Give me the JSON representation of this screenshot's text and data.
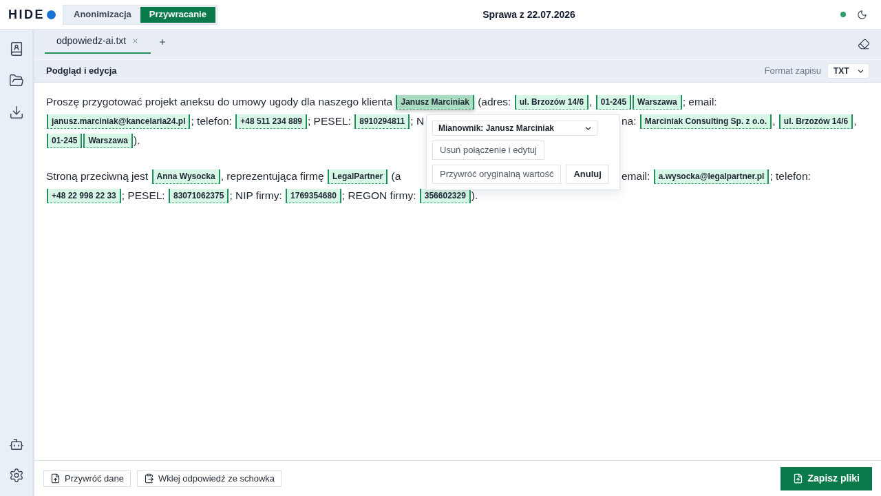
{
  "app": {
    "logo": "HIDE",
    "modes": [
      {
        "label": "Anonimizacja",
        "selected": false
      },
      {
        "label": "Przywracanie",
        "selected": true
      }
    ],
    "case_title": "Sprawa z 22.07.2026"
  },
  "file_tabs": [
    {
      "label": "odpowiedz-ai.txt",
      "selected": true
    }
  ],
  "toolbar": {
    "title": "Podgląd i edycja",
    "format_label": "Format zapisu",
    "format_value": "TXT"
  },
  "document": {
    "paragraphs": [
      {
        "lines": [
          {
            "segments": [
              {
                "kind": "text",
                "text": "Proszę przygotować projekt aneksu do umowy ugody dla naszego klienta "
              },
              {
                "kind": "entity",
                "text": "Janusz Marciniak",
                "selected": true
              },
              {
                "kind": "text",
                "text": " (adres: "
              },
              {
                "kind": "entity",
                "text": "ul. Brzozów 14/6",
                "selected": false
              },
              {
                "kind": "text",
                "text": ", "
              },
              {
                "kind": "entity",
                "text": "01-245",
                "selected": false
              },
              {
                "kind": "entity",
                "text": "Warszawa",
                "selected": false
              },
              {
                "kind": "text",
                "text": "; email:"
              }
            ]
          },
          {
            "segments": [
              {
                "kind": "entity",
                "text": "janusz.marciniak@kancelaria24.pl",
                "selected": false
              },
              {
                "kind": "text",
                "text": "; telefon: "
              },
              {
                "kind": "entity",
                "text": "+48 511 234 889",
                "selected": false
              },
              {
                "kind": "text",
                "text": "; PESEL: "
              },
              {
                "kind": "entity",
                "text": "8910294811",
                "selected": false
              },
              {
                "kind": "text",
                "text": "; N"
              }
            ],
            "after_popup": [
              {
                "kind": "text",
                "text": "na: "
              },
              {
                "kind": "entity",
                "text": "Marciniak Consulting Sp. z o.o.",
                "selected": false
              },
              {
                "kind": "text",
                "text": ", "
              },
              {
                "kind": "entity",
                "text": "ul. Brzozów 14/6",
                "selected": false
              },
              {
                "kind": "text",
                "text": ","
              }
            ]
          },
          {
            "segments": [
              {
                "kind": "entity",
                "text": "01-245",
                "selected": false
              },
              {
                "kind": "entity",
                "text": "Warszawa",
                "selected": false
              },
              {
                "kind": "text",
                "text": ")."
              }
            ]
          }
        ]
      },
      {
        "lines": [
          {
            "segments": [
              {
                "kind": "text",
                "text": "Stroną przeciwną jest "
              },
              {
                "kind": "entity",
                "text": "Anna Wysocka",
                "selected": false
              },
              {
                "kind": "text",
                "text": ", reprezentująca firmę "
              },
              {
                "kind": "entity",
                "text": "LegalPartner",
                "selected": false
              },
              {
                "kind": "text",
                "text": " (a"
              }
            ],
            "after_popup": [
              {
                "kind": "text",
                "text": "email: "
              },
              {
                "kind": "entity",
                "text": "a.wysocka@legalpartner.pl",
                "selected": false
              },
              {
                "kind": "text",
                "text": "; telefon:"
              }
            ]
          },
          {
            "segments": [
              {
                "kind": "entity",
                "text": "+48 22 998 22 33",
                "selected": false
              },
              {
                "kind": "text",
                "text": "; PESEL: "
              },
              {
                "kind": "entity",
                "text": "83071062375",
                "selected": false
              },
              {
                "kind": "text",
                "text": "; NIP firmy: "
              },
              {
                "kind": "entity",
                "text": "1769354680",
                "selected": false
              },
              {
                "kind": "text",
                "text": "; REGON firmy: "
              },
              {
                "kind": "entity",
                "text": "356602329",
                "selected": false
              },
              {
                "kind": "text",
                "text": ")."
              }
            ]
          }
        ]
      }
    ]
  },
  "popup": {
    "case_select": "Mianownik: Janusz Marciniak",
    "rows": [
      {
        "buttons": [
          {
            "label": "Usuń połączenie i edytuj",
            "kind": "muted"
          }
        ]
      },
      {
        "buttons": [
          {
            "label": "Przywróć oryginalną wartość",
            "kind": "muted"
          },
          {
            "label": "Anuluj",
            "kind": "strong"
          }
        ]
      }
    ]
  },
  "footer": {
    "buttons": [
      {
        "label": "Przywróć dane",
        "kind": "restore"
      },
      {
        "label": "Wklej odpowiedź ze schowka",
        "kind": "paste"
      }
    ],
    "save": "Zapisz pliki"
  }
}
